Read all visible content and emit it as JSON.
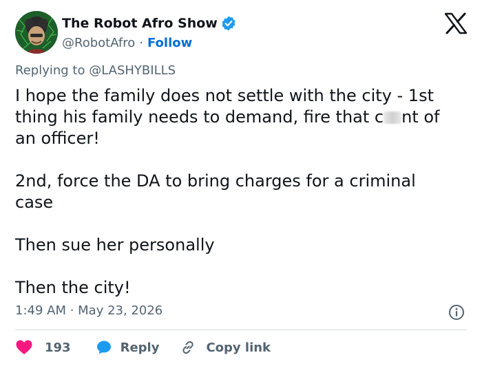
{
  "author": {
    "display_name": "The Robot Afro Show",
    "handle": "@RobotAfro",
    "separator": "·",
    "follow_label": "Follow",
    "verified_color": "#1d9bf0"
  },
  "replying_to": "Replying to @LASHYBILLS",
  "tweet": {
    "line1": "I hope the family does not settle with the city - 1st",
    "line2_a": "thing his family needs to demand, fire that c",
    "line2_b": "nt of",
    "line3": "an officer!",
    "line4": "2nd, force the DA to bring charges for a criminal",
    "line5": "case",
    "line6": "Then sue her personally",
    "line7": "Then the city!"
  },
  "timestamp": "1:49 AM · May 23, 2026",
  "actions": {
    "like_count": "193",
    "reply_label": "Reply",
    "copy_label": "Copy link",
    "like_color": "#f91880",
    "reply_color": "#1d9bf0"
  },
  "icons": [
    "avatar",
    "verified-badge-icon",
    "x-logo-icon",
    "info-icon",
    "heart-icon",
    "reply-bubble-icon",
    "link-icon"
  ]
}
